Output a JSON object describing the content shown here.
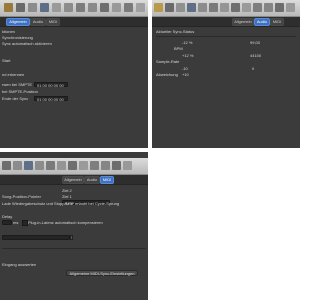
{
  "window1": {
    "tabs": [
      "Allgemein",
      "Audio",
      "MIDI"
    ],
    "lines": [
      "ktionen",
      "Synchronisierung",
      "Sync automatisch aktivieren",
      "Start",
      "nd erkennen",
      "rwen bei SMPTE",
      "bei SMPTE-Position",
      "Ende der Sync"
    ],
    "start_field": "01 00 00 00 00",
    "smpte_field": "01 00 00 00 00"
  },
  "window2": {
    "tabs": [
      "Allgemein",
      "Audio",
      "MIDI"
    ],
    "sync_status_label": "Aktueller Sync-Status",
    "bpm_label": "BPM",
    "bpm_small": "-12 %",
    "bpm_value": "99,00",
    "bpm_small2": "+12 %",
    "rate_value": "44100",
    "sample_rate_label": "Sample-Rate",
    "sample_small": "-10",
    "sample_small2": "+10",
    "rate_label": "Abweichung",
    "rate_value2": "0"
  },
  "window3": {
    "title": "Logic Pro X",
    "tabs": [
      "Allgemein",
      "Audio",
      "MIDI"
    ],
    "lines": [
      "Ziel 2",
      "Ziel 1",
      "Kein",
      "Song-Position-Pointer",
      "Lade Wiedergabeschutz und Stopp/MTP erlaubt bei Cycle-Sprung",
      "Delay",
      "ms",
      "Plug-in-Latenz automatisch kompensieren",
      "Eingang auswerten",
      "Allgemeine MIDI-Sync-Einstellungen"
    ]
  },
  "colors": {
    "accent": "#3f71c2",
    "panel": "#3b3b3b",
    "toolbar": "#c8c8c8"
  }
}
